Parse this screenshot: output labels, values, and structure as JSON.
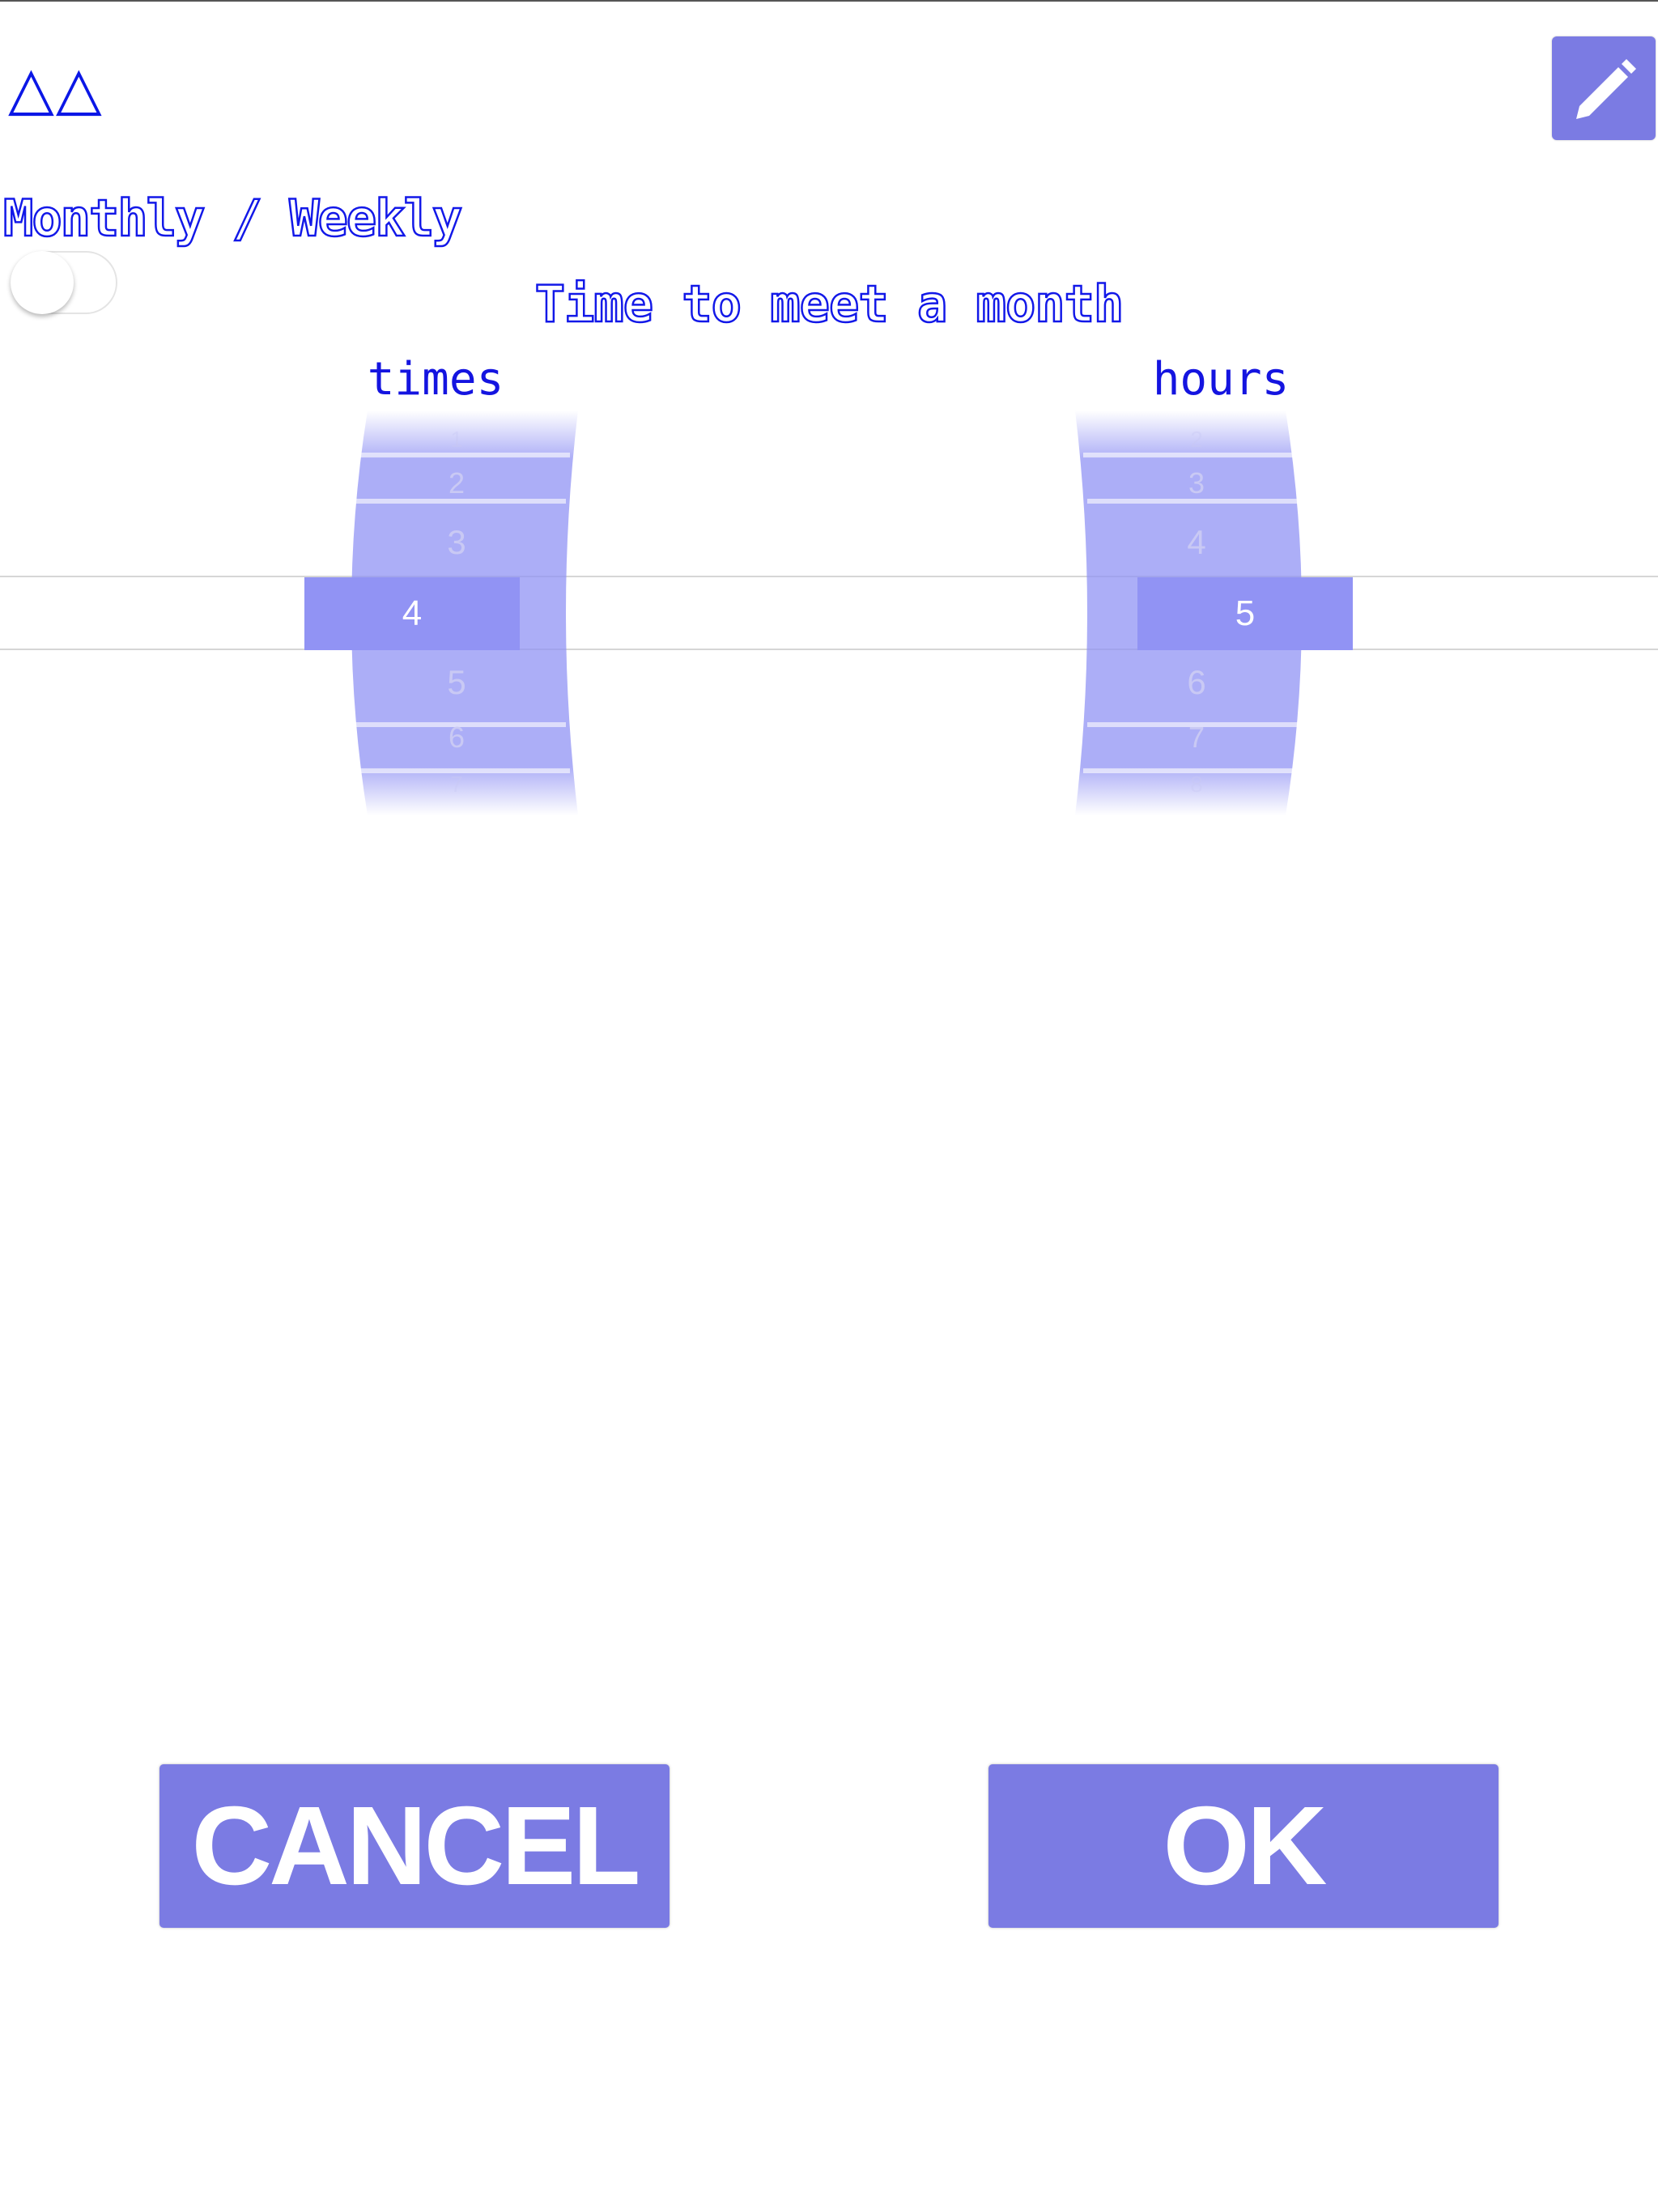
{
  "header": {
    "title": "△△",
    "edit_icon": "pencil-icon"
  },
  "mode": {
    "label": "Monthly / Weekly",
    "toggle_on": false
  },
  "section_title": "Time to meet a month",
  "pickers": {
    "times": {
      "header": "times",
      "above": [
        "1",
        "2",
        "3"
      ],
      "selected": "4",
      "below": [
        "5",
        "6",
        "7"
      ]
    },
    "hours": {
      "header": "hours",
      "above": [
        "2",
        "3",
        "4"
      ],
      "selected": "5",
      "below": [
        "6",
        "7",
        "8"
      ]
    }
  },
  "buttons": {
    "cancel": "CANCEL",
    "ok": "OK"
  },
  "colors": {
    "accent": "#7b7be3",
    "selected": "#9193f4",
    "title_blue": "#1218e8"
  }
}
